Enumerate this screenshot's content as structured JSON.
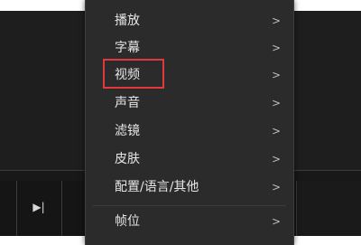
{
  "player": {
    "control_button_glyph": "▶|"
  },
  "context_menu": {
    "items": [
      {
        "label": "播放",
        "arrow": ">"
      },
      {
        "label": "字幕",
        "arrow": ">"
      },
      {
        "label": "视频",
        "arrow": ">"
      },
      {
        "label": "声音",
        "arrow": ">"
      },
      {
        "label": "滤镜",
        "arrow": ">"
      },
      {
        "label": "皮肤",
        "arrow": ">"
      },
      {
        "label": "配置/语言/其他",
        "arrow": ">"
      },
      {
        "label": "帧位",
        "arrow": ">"
      }
    ]
  },
  "annotation": {
    "highlight_color": "#e0383d",
    "highlighted_item": "视频"
  },
  "colors": {
    "menu_background": "#2b2b2b",
    "menu_text": "#e6e6e6",
    "player_background": "#181818"
  }
}
